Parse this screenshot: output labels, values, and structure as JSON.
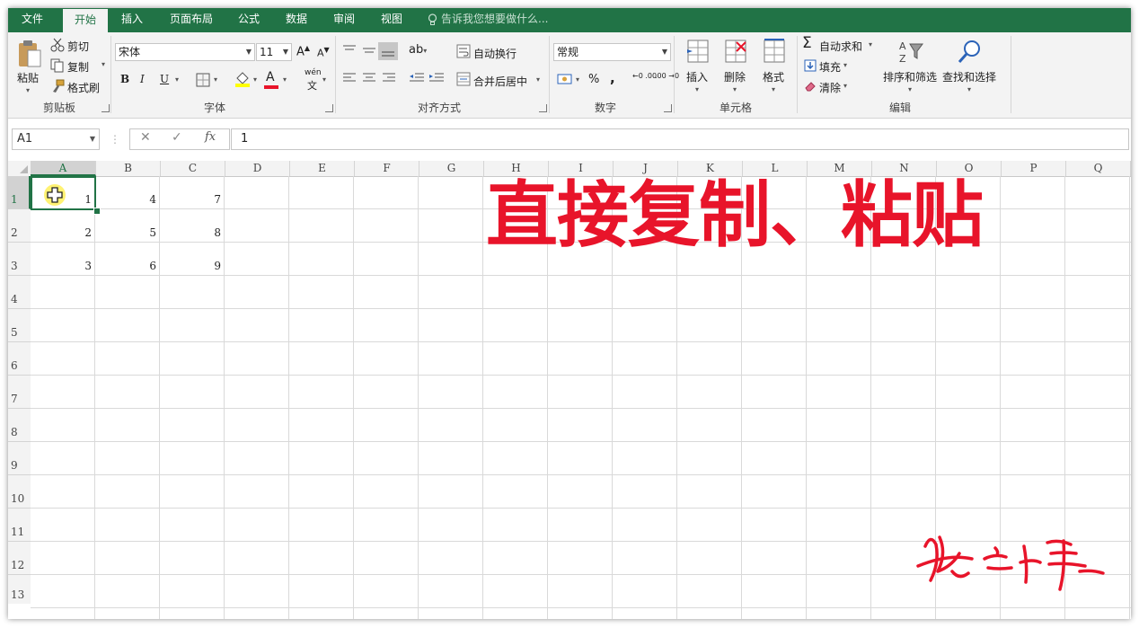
{
  "tabs": [
    "文件",
    "开始",
    "插入",
    "页面布局",
    "公式",
    "数据",
    "审阅",
    "视图"
  ],
  "active_tab": "开始",
  "tell_me": "告诉我您想要做什么...",
  "clipboard": {
    "paste": "粘贴",
    "cut": "剪切",
    "copy": "复制",
    "format_painter": "格式刷",
    "label": "剪贴板"
  },
  "font": {
    "name": "宋体",
    "size": "11",
    "bold": "B",
    "italic": "I",
    "underline": "U",
    "font_color_letter": "A",
    "wen": "wén",
    "wen2": "文",
    "label": "字体"
  },
  "alignment": {
    "wrap_text": "自动换行",
    "merge_center": "合并后居中",
    "label": "对齐方式"
  },
  "number": {
    "format": "常规",
    "percent": "%",
    "comma": ",",
    "inc_decimal": "←0 .00",
    "dec_decimal": ".00 →0",
    "label": "数字"
  },
  "cells_group": {
    "insert": "插入",
    "delete": "删除",
    "format": "格式",
    "label": "单元格"
  },
  "editing": {
    "autosum": "自动求和",
    "fill": "填充",
    "clear": "清除",
    "sort_filter": "排序和筛选",
    "find_select": "查找和选择",
    "label": "编辑"
  },
  "formula_bar": {
    "name_box": "A1",
    "value": "1",
    "fx": "fx"
  },
  "columns": [
    "A",
    "B",
    "C",
    "D",
    "E",
    "F",
    "G",
    "H",
    "I",
    "J",
    "K",
    "L",
    "M",
    "N",
    "O",
    "P",
    "Q"
  ],
  "rows": [
    "1",
    "2",
    "3",
    "4",
    "5",
    "6",
    "7",
    "8",
    "9",
    "10",
    "11",
    "12",
    "13"
  ],
  "cells": [
    [
      "1",
      "4",
      "7"
    ],
    [
      "2",
      "5",
      "8"
    ],
    [
      "3",
      "6",
      "9"
    ]
  ],
  "overlay_title": "直接复制、粘贴",
  "accent_color": "#217346",
  "title_color": "#e8142a",
  "signature_color": "#e8142a"
}
